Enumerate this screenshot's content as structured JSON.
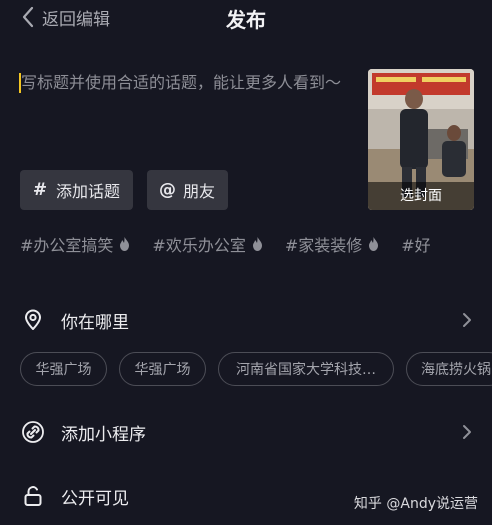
{
  "header": {
    "back_label": "返回编辑",
    "title": "发布"
  },
  "caption": {
    "placeholder": "写标题并使用合适的话题，能让更多人看到～"
  },
  "cover": {
    "label": "选封面"
  },
  "chips": [
    {
      "icon": "hash-icon",
      "label": "添加话题"
    },
    {
      "icon": "at-icon",
      "label": "朋友"
    }
  ],
  "hashtags": [
    {
      "label": "#办公室搞笑",
      "hot": true
    },
    {
      "label": "#欢乐办公室",
      "hot": true
    },
    {
      "label": "#家装装修",
      "hot": true
    },
    {
      "label": "#好",
      "hot": false
    }
  ],
  "location": {
    "label": "你在哪里",
    "suggestions": [
      "华强广场",
      "华强广场",
      "河南省国家大学科技…",
      "海底捞火锅"
    ]
  },
  "mini_program": {
    "label": "添加小程序"
  },
  "visibility": {
    "label": "公开可见"
  },
  "watermark": "知乎 @Andy说运营",
  "colors": {
    "background": "#161722",
    "chip": "#35363f",
    "caret": "#f3c623"
  }
}
